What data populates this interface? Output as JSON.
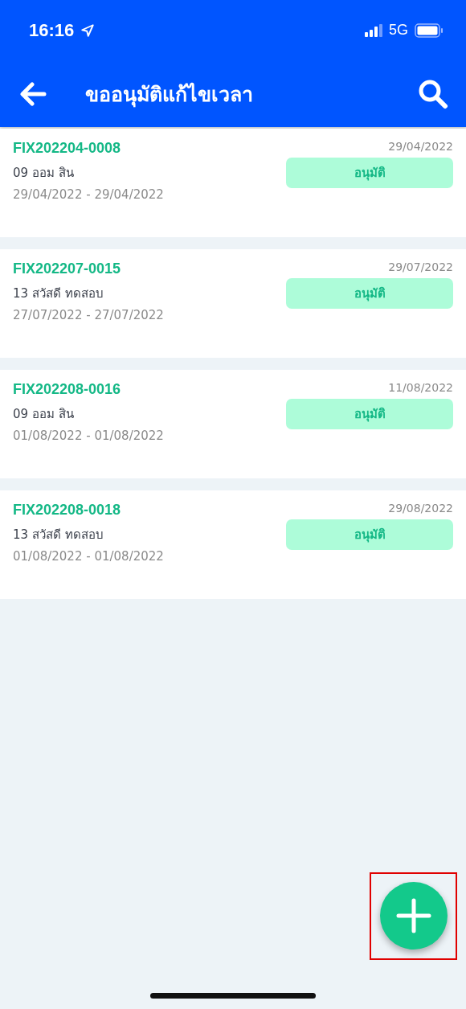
{
  "status_bar": {
    "time": "16:16",
    "network": "5G"
  },
  "header": {
    "title": "ขออนุมัติแก้ไขเวลา"
  },
  "requests": [
    {
      "code": "FIX202204-0008",
      "date": "29/04/2022",
      "employee": "09 ออม สิน",
      "range": "29/04/2022 - 29/04/2022",
      "status": "อนุมัติ"
    },
    {
      "code": "FIX202207-0015",
      "date": "29/07/2022",
      "employee": "13 สวัสดี ทดสอบ",
      "range": "27/07/2022 - 27/07/2022",
      "status": "อนุมัติ"
    },
    {
      "code": "FIX202208-0016",
      "date": "11/08/2022",
      "employee": "09 ออม สิน",
      "range": "01/08/2022 - 01/08/2022",
      "status": "อนุมัติ"
    },
    {
      "code": "FIX202208-0018",
      "date": "29/08/2022",
      "employee": "13 สวัสดี ทดสอบ",
      "range": "01/08/2022 - 01/08/2022",
      "status": "อนุมัติ"
    }
  ],
  "add_button": {
    "highlighted": true
  }
}
